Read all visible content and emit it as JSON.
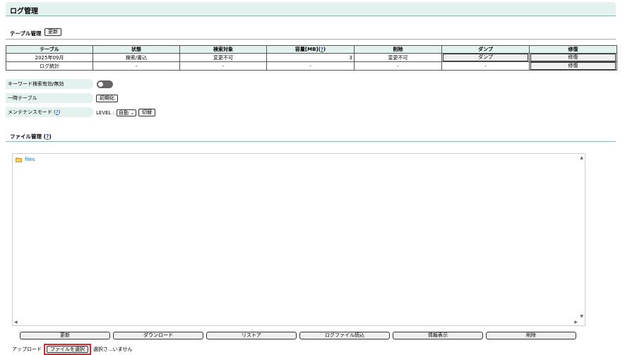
{
  "header": {
    "title": "ログ管理"
  },
  "table_section": {
    "title": "テーブル管理",
    "update_label": "更新",
    "columns": [
      "テーブル",
      "状態",
      "検索対象",
      "容量[MB](?)",
      "削除",
      "ダンプ",
      "修復"
    ],
    "col_capacity_label": "容量[MB](",
    "col_capacity_help": "?",
    "col_capacity_close": ")",
    "rows": [
      {
        "table": "2025年09月",
        "state": "検索/書込",
        "search": "変更不可",
        "capacity": "3",
        "delete": "変更不可",
        "dump": "ダンプ",
        "repair": "修復"
      },
      {
        "table": "ログ統計",
        "state": "-",
        "search": "-",
        "capacity": "-",
        "delete": "-",
        "dump": "-",
        "repair": "修復"
      }
    ]
  },
  "settings": {
    "keyword_label": "キーワード検索有効/無効",
    "temp_table_label": "一時テーブル",
    "init_label": "初期化",
    "maintenance_label": "メンテナンスモード (",
    "maintenance_help": "?",
    "maintenance_close": ")",
    "level_label": "LEVEL :",
    "level_value": "自動",
    "switch_label": "切替"
  },
  "file_section": {
    "title": "ファイル管理 (",
    "help": "?",
    "close": ")",
    "tree_root": "files",
    "actions": [
      "更新",
      "ダウンロード",
      "リストア",
      "ログファイル読込",
      "情報表示",
      "削除"
    ]
  },
  "upload": {
    "label": "アップロード",
    "choose_label": "ファイルを選択",
    "status": "選択さ...いません"
  },
  "colors": {
    "header_bg": "#e3f1ef",
    "line": "#8fb7b2",
    "highlight": "#d9232e",
    "link": "#1a4fb8"
  }
}
